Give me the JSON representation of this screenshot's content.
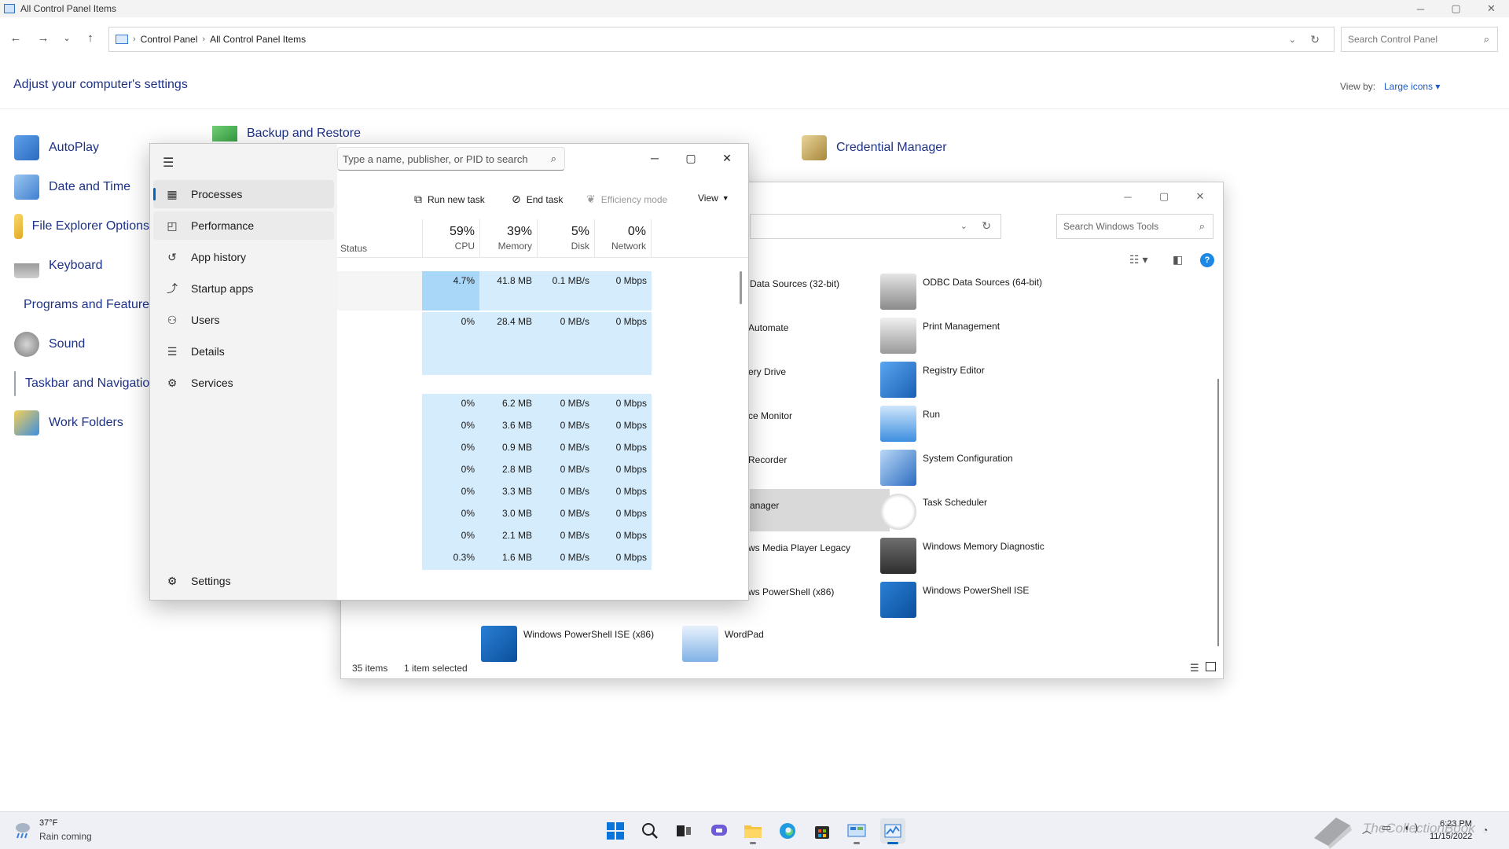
{
  "control_panel": {
    "title": "All Control Panel Items",
    "breadcrumb": [
      "Control Panel",
      "All Control Panel Items"
    ],
    "search_placeholder": "Search Control Panel",
    "heading": "Adjust your computer's settings",
    "view_by_label": "View by:",
    "view_by_value": "Large icons",
    "items_col1": [
      "AutoPlay",
      "Date and Time",
      "File Explorer Options",
      "Keyboard",
      "Programs and Features",
      "Sound",
      "Taskbar and Navigation",
      "Work Folders"
    ],
    "items_top": [
      "Backup and Restore",
      "Credential Manager"
    ]
  },
  "windows_tools": {
    "search_placeholder": "Search Windows Tools",
    "items_left": [
      "Data Sources (32-bit)",
      "Automate",
      "ery Drive",
      "ce Monitor",
      "Recorder",
      "anager",
      "ws Media Player Legacy",
      "ws PowerShell (x86)"
    ],
    "items_right": [
      "ODBC Data Sources (64-bit)",
      "Print Management",
      "Registry Editor",
      "Run",
      "System Configuration",
      "Task Scheduler",
      "Windows Memory Diagnostic",
      "Windows PowerShell ISE"
    ],
    "items_bottom": [
      "Windows PowerShell ISE (x86)",
      "WordPad"
    ],
    "status_count": "35 items",
    "status_selected": "1 item selected"
  },
  "task_manager": {
    "search_placeholder": "Type a name, publisher, or PID to search",
    "nav": [
      {
        "icon": "processes-icon",
        "label": "Processes"
      },
      {
        "icon": "performance-icon",
        "label": "Performance"
      },
      {
        "icon": "app-history-icon",
        "label": "App history"
      },
      {
        "icon": "startup-apps-icon",
        "label": "Startup apps"
      },
      {
        "icon": "users-icon",
        "label": "Users"
      },
      {
        "icon": "details-icon",
        "label": "Details"
      },
      {
        "icon": "services-icon",
        "label": "Services"
      }
    ],
    "settings_label": "Settings",
    "commands": {
      "run_new_task": "Run new task",
      "end_task": "End task",
      "efficiency_mode": "Efficiency mode",
      "view": "View"
    },
    "columns": {
      "status": "Status",
      "cpu": {
        "pct": "59%",
        "name": "CPU"
      },
      "memory": {
        "pct": "39%",
        "name": "Memory"
      },
      "disk": {
        "pct": "5%",
        "name": "Disk"
      },
      "network": {
        "pct": "0%",
        "name": "Network"
      }
    },
    "rows": [
      {
        "cpu": "4.7%",
        "memory": "41.8 MB",
        "disk": "0.1 MB/s",
        "network": "0 Mbps"
      },
      {
        "cpu": "0%",
        "memory": "28.4 MB",
        "disk": "0 MB/s",
        "network": "0 Mbps"
      },
      {
        "cpu": "0%",
        "memory": "6.2 MB",
        "disk": "0 MB/s",
        "network": "0 Mbps"
      },
      {
        "cpu": "0%",
        "memory": "3.6 MB",
        "disk": "0 MB/s",
        "network": "0 Mbps"
      },
      {
        "cpu": "0%",
        "memory": "0.9 MB",
        "disk": "0 MB/s",
        "network": "0 Mbps"
      },
      {
        "cpu": "0%",
        "memory": "2.8 MB",
        "disk": "0 MB/s",
        "network": "0 Mbps"
      },
      {
        "cpu": "0%",
        "memory": "3.3 MB",
        "disk": "0 MB/s",
        "network": "0 Mbps"
      },
      {
        "cpu": "0%",
        "memory": "3.0 MB",
        "disk": "0 MB/s",
        "network": "0 Mbps"
      },
      {
        "cpu": "0%",
        "memory": "2.1 MB",
        "disk": "0 MB/s",
        "network": "0 Mbps"
      },
      {
        "cpu": "0.3%",
        "memory": "1.6 MB",
        "disk": "0 MB/s",
        "network": "0 Mbps"
      }
    ]
  },
  "taskbar": {
    "weather_temp": "37°F",
    "weather_desc": "Rain coming",
    "time": "6:23 PM",
    "date": "11/15/2022",
    "apps": [
      "start-icon",
      "search-icon",
      "task-view-icon",
      "chat-icon",
      "file-explorer-icon",
      "edge-icon",
      "store-icon",
      "control-panel-icon",
      "task-manager-icon"
    ],
    "watermark": "TheCollectionBook"
  },
  "colors": {
    "accent": "#0067c0",
    "heat_light": "#d4ecfc",
    "heat_strong": "#a9d7f7",
    "link": "#1e3287"
  }
}
